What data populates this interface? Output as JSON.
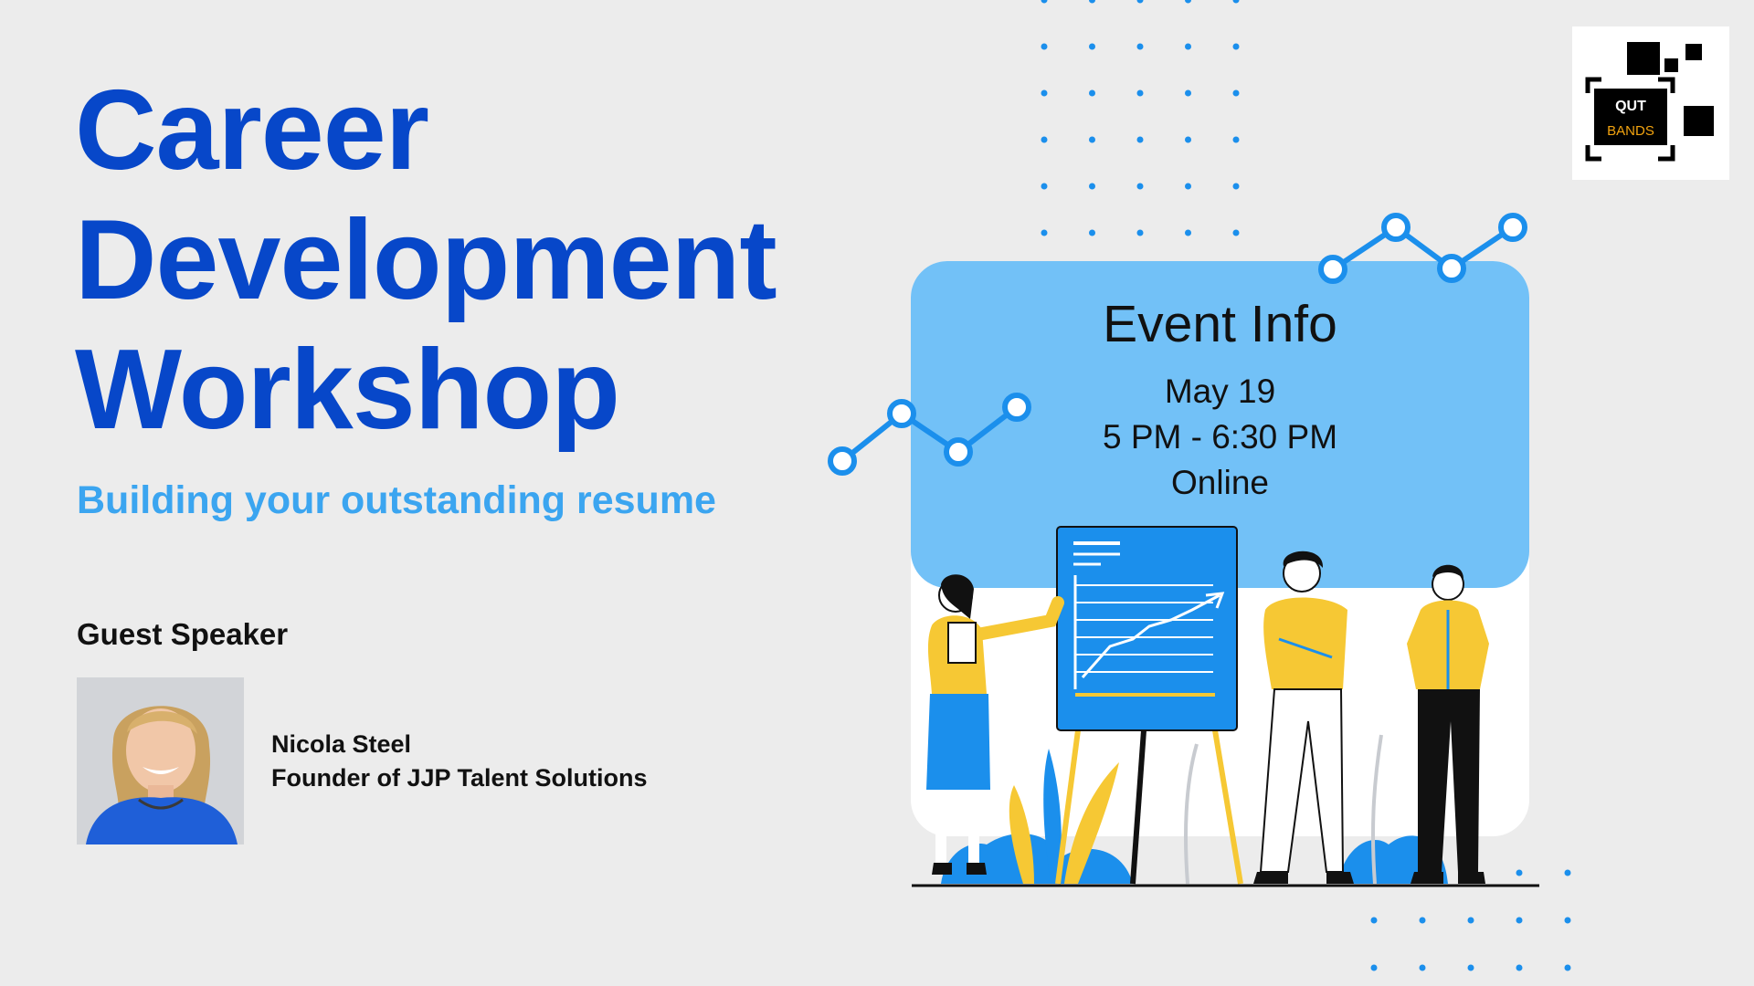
{
  "title_lines": [
    "Career",
    "Development",
    "Workshop"
  ],
  "subtitle": "Building your outstanding resume",
  "guest_label": "Guest Speaker",
  "speaker": {
    "name": "Nicola Steel",
    "role": "Founder of JJP Talent Solutions"
  },
  "logo": {
    "line1": "QUT",
    "line2": "BANDS"
  },
  "event": {
    "title": "Event Info",
    "date": "May 19",
    "time": "5 PM - 6:30 PM",
    "location": "Online"
  },
  "colors": {
    "title": "#0747c9",
    "subtitle": "#3ba5f0",
    "card": "#72c1f7",
    "accent_blue": "#1b8fec",
    "accent_yellow": "#f6c834",
    "background": "#ececec"
  }
}
